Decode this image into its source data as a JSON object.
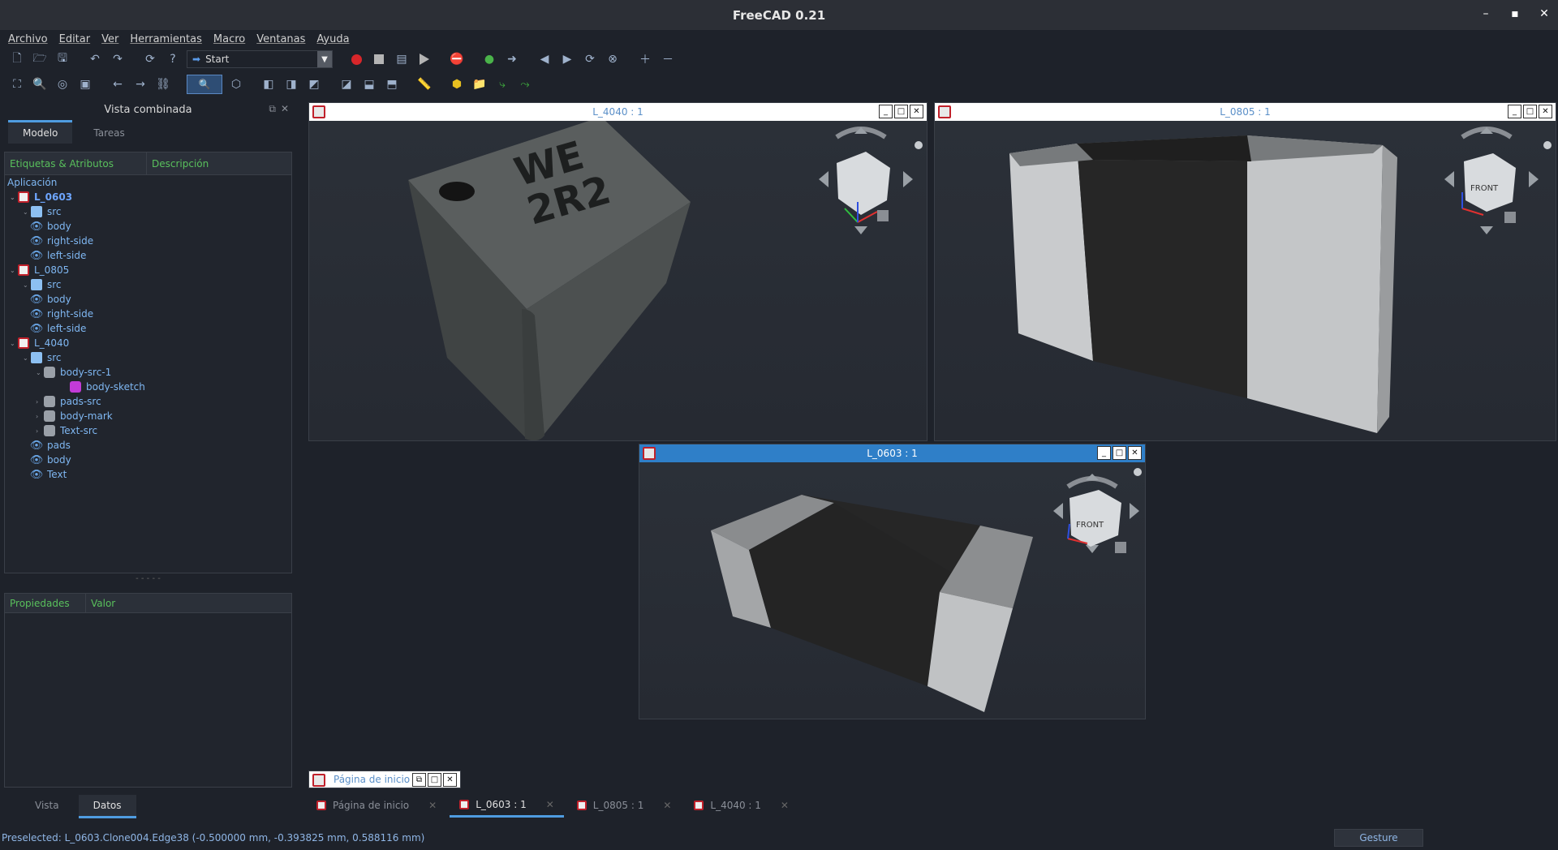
{
  "window": {
    "title": "FreeCAD 0.21"
  },
  "menu": [
    "Archivo",
    "Editar",
    "Ver",
    "Herramientas",
    "Macro",
    "Ventanas",
    "Ayuda"
  ],
  "toolbar": {
    "workbench": "Start"
  },
  "combo": {
    "title": "Vista combinada",
    "tabs": [
      "Modelo",
      "Tareas"
    ],
    "tree_headers": [
      "Etiquetas & Atributos",
      "Descripción"
    ],
    "app_label": "Aplicación",
    "tree": [
      {
        "label": "L_0603",
        "level": 1,
        "icon": "document-icon",
        "selected": true
      },
      {
        "label": "src",
        "level": 2,
        "icon": "folder-icon"
      },
      {
        "label": "body",
        "level": 2,
        "icon": "link-icon"
      },
      {
        "label": "right-side",
        "level": 2,
        "icon": "link-icon"
      },
      {
        "label": "left-side",
        "level": 2,
        "icon": "link-icon"
      },
      {
        "label": "L_0805",
        "level": 1,
        "icon": "document-icon"
      },
      {
        "label": "src",
        "level": 2,
        "icon": "folder-icon"
      },
      {
        "label": "body",
        "level": 2,
        "icon": "link-icon"
      },
      {
        "label": "right-side",
        "level": 2,
        "icon": "link-icon"
      },
      {
        "label": "left-side",
        "level": 2,
        "icon": "link-icon"
      },
      {
        "label": "L_4040",
        "level": 1,
        "icon": "document-icon"
      },
      {
        "label": "src",
        "level": 2,
        "icon": "folder-icon"
      },
      {
        "label": "body-src-1",
        "level": 3,
        "icon": "body-icon"
      },
      {
        "label": "body-sketch",
        "level": 4,
        "icon": "sketch-icon"
      },
      {
        "label": "pads-src",
        "level": 3,
        "icon": "body-icon"
      },
      {
        "label": "body-mark",
        "level": 3,
        "icon": "body-icon"
      },
      {
        "label": "Text-src",
        "level": 3,
        "icon": "body-icon"
      },
      {
        "label": "pads",
        "level": 2,
        "icon": "link-icon"
      },
      {
        "label": "body",
        "level": 2,
        "icon": "link-icon"
      },
      {
        "label": "Text",
        "level": 2,
        "icon": "link-icon"
      }
    ],
    "props_headers": [
      "Propiedades",
      "Valor"
    ],
    "bottom_tabs": [
      "Vista",
      "Datos"
    ]
  },
  "subwindows": {
    "l4040": {
      "title": "L_4040 : 1",
      "marking_line1": "WE",
      "marking_line2": "2R2"
    },
    "l0805": {
      "title": "L_0805 : 1",
      "cube_label": "FRONT"
    },
    "l0603": {
      "title": "L_0603 : 1",
      "cube_label": "FRONT"
    },
    "start": {
      "title": "Página de inicio"
    }
  },
  "doc_tabs": [
    "Página de inicio",
    "L_0603 : 1",
    "L_0805 : 1",
    "L_4040 : 1"
  ],
  "status": {
    "message": "Preselected: L_0603.Clone004.Edge38 (-0.500000 mm, -0.393825 mm, 0.588116 mm)",
    "nav_style": "Gesture"
  }
}
